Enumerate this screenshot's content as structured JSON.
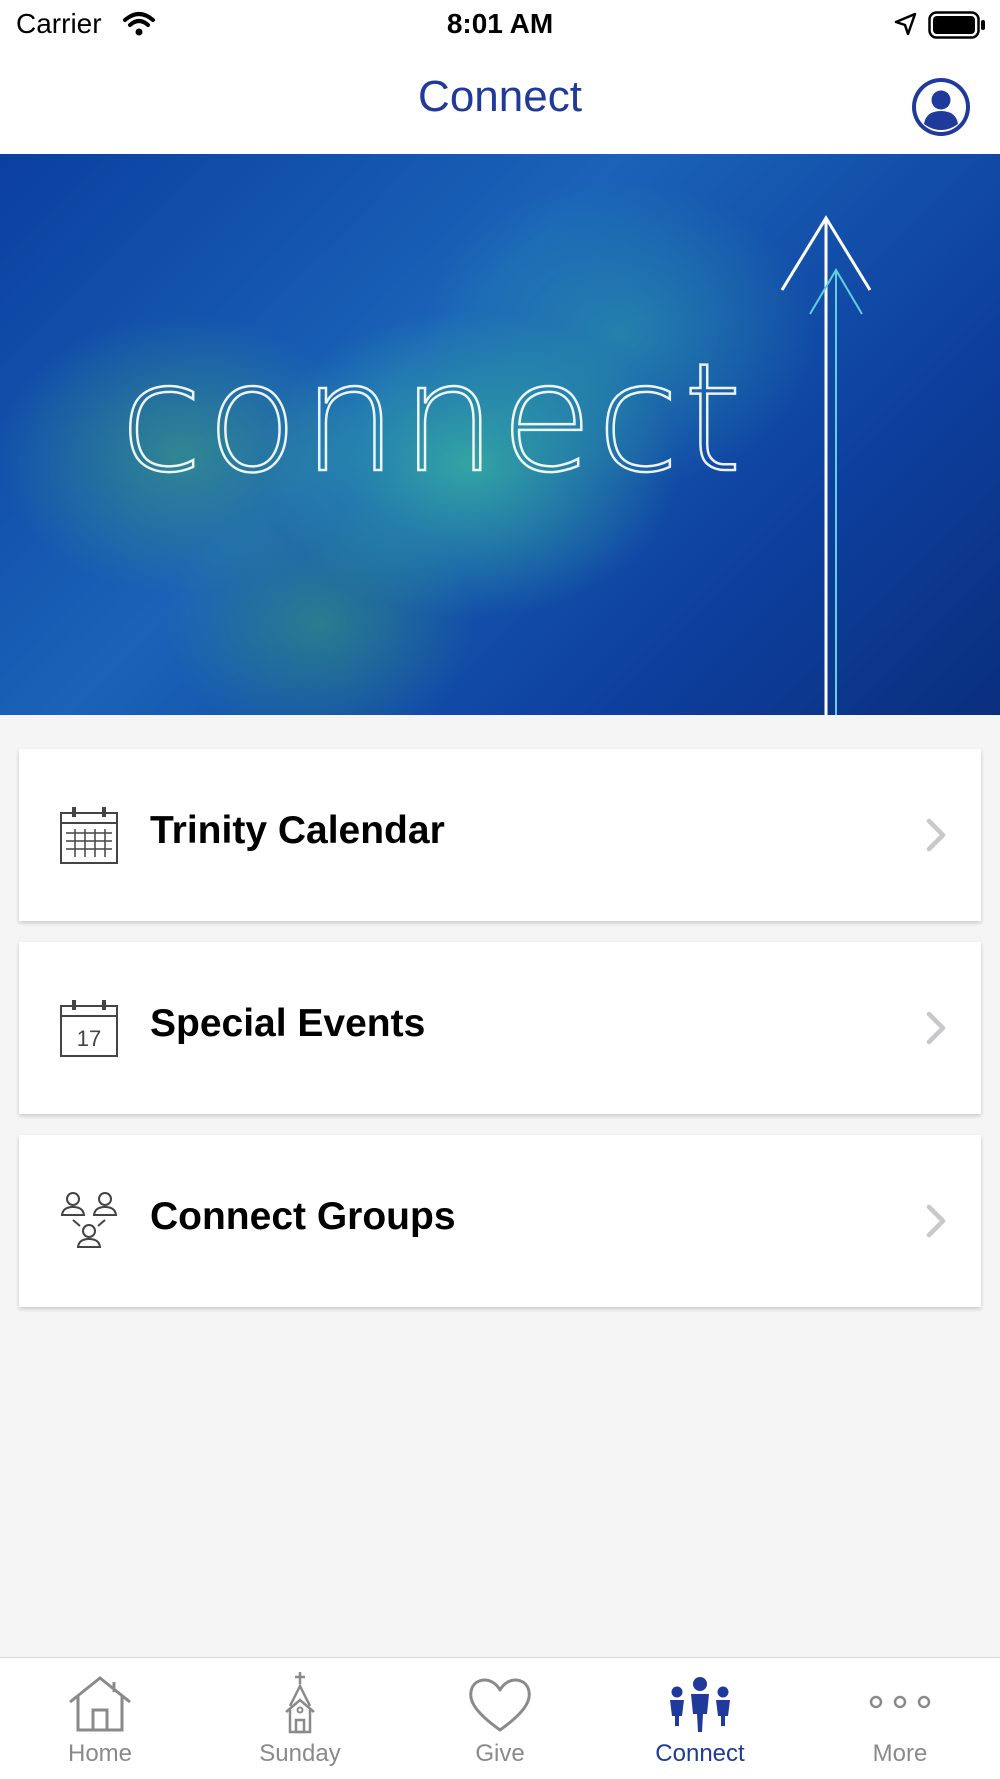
{
  "status_bar": {
    "carrier": "Carrier",
    "time": "8:01 AM"
  },
  "nav": {
    "title": "Connect"
  },
  "hero": {
    "word": "connect"
  },
  "menu": {
    "items": [
      {
        "label": "Trinity Calendar",
        "icon": "calendar-grid-icon"
      },
      {
        "label": "Special Events",
        "icon": "calendar-date-icon",
        "icon_text": "17"
      },
      {
        "label": "Connect Groups",
        "icon": "people-group-icon"
      }
    ]
  },
  "tab_bar": {
    "tabs": [
      {
        "label": "Home",
        "icon": "house-icon"
      },
      {
        "label": "Sunday",
        "icon": "church-icon"
      },
      {
        "label": "Give",
        "icon": "heart-icon"
      },
      {
        "label": "Connect",
        "icon": "people-icon",
        "active": true
      },
      {
        "label": "More",
        "icon": "more-dots-icon"
      }
    ]
  },
  "colors": {
    "accent": "#1f3a9b",
    "inactive": "#8a8a8a",
    "background": "#f5f5f5"
  }
}
